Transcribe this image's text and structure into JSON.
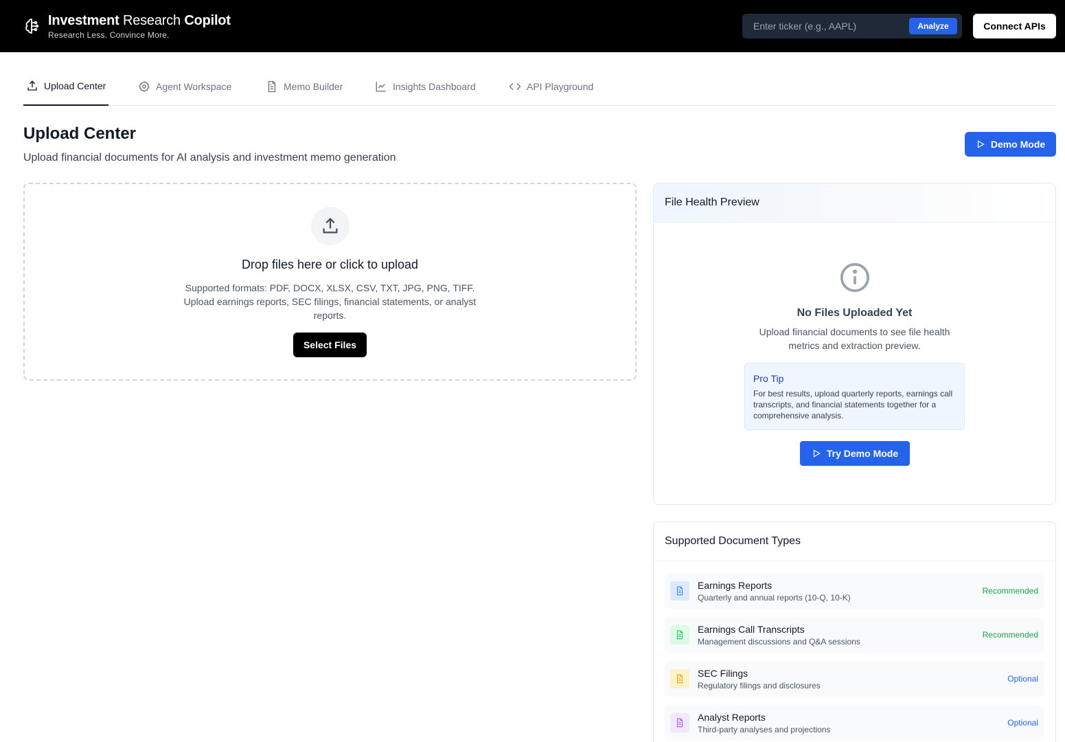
{
  "header": {
    "title_bold_1": "Investment",
    "title_light": " Research ",
    "title_bold_2": "Copilot",
    "subtitle": "Research Less. Convince More.",
    "ticker_placeholder": "Enter ticker (e.g., AAPL)",
    "analyze_label": "Analyze",
    "connect_label": "Connect APIs"
  },
  "tabs": [
    {
      "label": "Upload Center",
      "icon": "upload-icon",
      "active": true
    },
    {
      "label": "Agent Workspace",
      "icon": "gear-icon",
      "active": false
    },
    {
      "label": "Memo Builder",
      "icon": "document-icon",
      "active": false
    },
    {
      "label": "Insights Dashboard",
      "icon": "line-chart-icon",
      "active": false
    },
    {
      "label": "API Playground",
      "icon": "code-icon",
      "active": false
    }
  ],
  "page": {
    "title": "Upload Center",
    "subtitle": "Upload financial documents for AI analysis and investment memo generation",
    "demo_label": "Demo Mode"
  },
  "dropzone": {
    "title": "Drop files here or click to upload",
    "desc": "Supported formats: PDF, DOCX, XLSX, CSV, TXT, JPG, PNG, TIFF. Upload earnings reports, SEC filings, financial statements, or analyst reports.",
    "button": "Select Files"
  },
  "health": {
    "title": "File Health Preview",
    "empty_title": "No Files Uploaded Yet",
    "empty_desc": "Upload financial documents to see file health metrics and extraction preview.",
    "tip_title": "Pro Tip",
    "tip_text": "For best results, upload quarterly reports, earnings call transcripts, and financial statements together for a comprehensive analysis.",
    "try_demo_label": "Try Demo Mode"
  },
  "types": {
    "title": "Supported Document Types",
    "items": [
      {
        "name": "Earnings Reports",
        "desc": "Quarterly and annual reports (10-Q, 10-K)",
        "badge": "Recommended",
        "color": "#3b82f6",
        "bg": "#dbeafe",
        "badge_color": "#16a34a"
      },
      {
        "name": "Earnings Call Transcripts",
        "desc": "Management discussions and Q&A sessions",
        "badge": "Recommended",
        "color": "#22c55e",
        "bg": "#dcfce7",
        "badge_color": "#16a34a"
      },
      {
        "name": "SEC Filings",
        "desc": "Regulatory filings and disclosures",
        "badge": "Optional",
        "color": "#f59e0b",
        "bg": "#fef3c7",
        "badge_color": "#2563eb"
      },
      {
        "name": "Analyst Reports",
        "desc": "Third-party analyses and projections",
        "badge": "Optional",
        "color": "#a855f7",
        "bg": "#f3e8ff",
        "badge_color": "#2563eb"
      }
    ]
  }
}
